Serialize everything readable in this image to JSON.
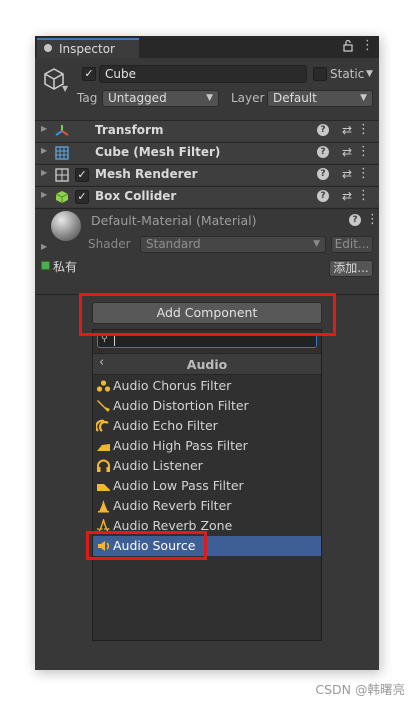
{
  "window": {
    "tab_label": "Inspector"
  },
  "object": {
    "name": "Cube",
    "active": true,
    "static_label": "Static"
  },
  "tag": {
    "label": "Tag",
    "value": "Untagged"
  },
  "layer": {
    "label": "Layer",
    "value": "Default"
  },
  "components": [
    {
      "label": "Transform",
      "icon": "transform-icon"
    },
    {
      "label": "Cube (Mesh Filter)",
      "icon": "mesh-filter-icon"
    },
    {
      "label": "Mesh Renderer",
      "icon": "mesh-renderer-icon",
      "enabled": true
    },
    {
      "label": "Box Collider",
      "icon": "box-collider-icon",
      "enabled": true
    }
  ],
  "material": {
    "title": "Default-Material (Material)",
    "shader_label": "Shader",
    "shader_value": "Standard",
    "edit_label": "Edit..."
  },
  "private": {
    "label": "私有",
    "add_label": "添加..."
  },
  "add_component": {
    "label": "Add Component"
  },
  "popup": {
    "search_value": "",
    "category": "Audio",
    "items": [
      {
        "label": "Audio Chorus Filter",
        "icon": "audio-chorus-filter-icon"
      },
      {
        "label": "Audio Distortion Filter",
        "icon": "audio-distortion-filter-icon"
      },
      {
        "label": "Audio Echo Filter",
        "icon": "audio-echo-filter-icon"
      },
      {
        "label": "Audio High Pass Filter",
        "icon": "audio-high-pass-filter-icon"
      },
      {
        "label": "Audio Listener",
        "icon": "audio-listener-icon"
      },
      {
        "label": "Audio Low Pass Filter",
        "icon": "audio-low-pass-filter-icon"
      },
      {
        "label": "Audio Reverb Filter",
        "icon": "audio-reverb-filter-icon"
      },
      {
        "label": "Audio Reverb Zone",
        "icon": "audio-reverb-zone-icon"
      },
      {
        "label": "Audio Source",
        "icon": "audio-source-icon",
        "selected": true
      }
    ]
  },
  "colors": {
    "accent": "#3a79bb",
    "selection": "#3e5f96",
    "highlight_box": "#e01b1b",
    "icon_yellow": "#f2b731"
  },
  "watermark": "CSDN @韩曙亮"
}
